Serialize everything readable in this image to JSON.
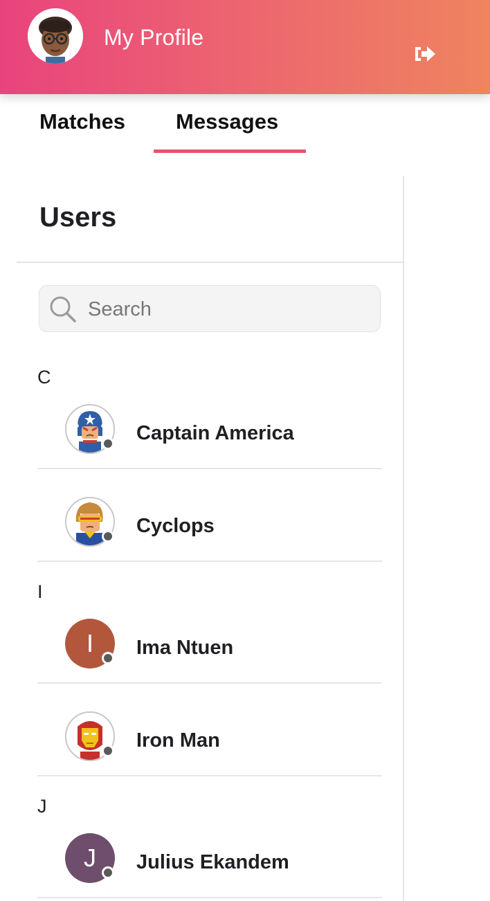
{
  "header": {
    "title": "My Profile",
    "logout_icon": "sign-out-icon",
    "gradient": [
      "#e9437d",
      "#ef845f"
    ]
  },
  "tabs": [
    {
      "label": "Matches",
      "active": false
    },
    {
      "label": "Messages",
      "active": true
    }
  ],
  "accent_color": "#e8546b",
  "users": {
    "title": "Users",
    "search": {
      "placeholder": "Search",
      "value": ""
    },
    "groups": [
      {
        "letter": "C",
        "items": [
          {
            "name": "Captain America",
            "avatar": "captain-america-avatar",
            "status": "offline"
          },
          {
            "name": "Cyclops",
            "avatar": "cyclops-avatar",
            "status": "offline"
          }
        ]
      },
      {
        "letter": "I",
        "items": [
          {
            "name": "Ima Ntuen",
            "avatar_letter": "I",
            "avatar_color": "#b3573c",
            "status": "offline"
          },
          {
            "name": "Iron Man",
            "avatar": "iron-man-avatar",
            "status": "offline"
          }
        ]
      },
      {
        "letter": "J",
        "items": [
          {
            "name": "Julius Ekandem",
            "avatar_letter": "J",
            "avatar_color": "#6e4e6c",
            "status": "offline"
          }
        ]
      }
    ]
  }
}
